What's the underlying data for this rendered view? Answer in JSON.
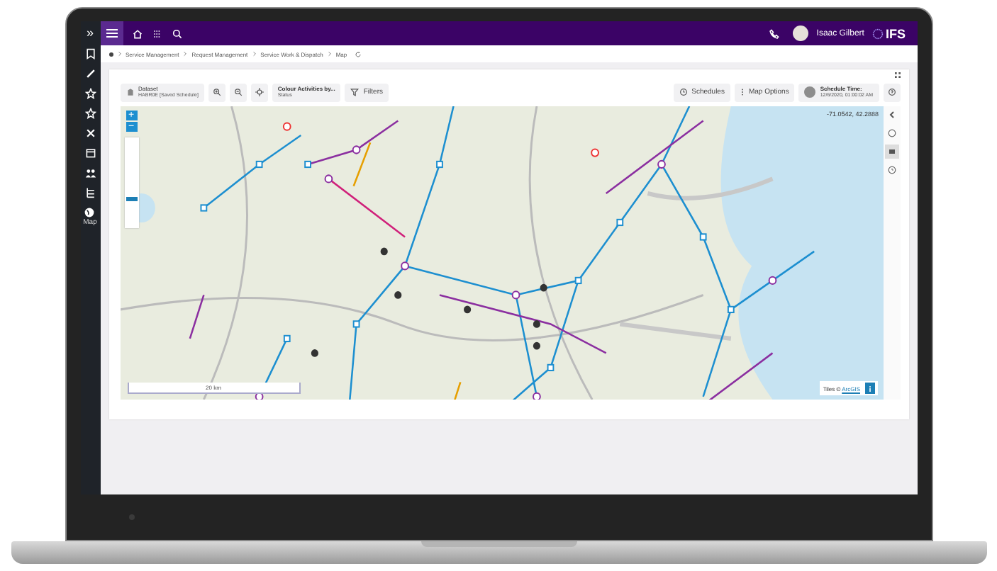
{
  "sidebar": {
    "toggle": "»",
    "items": [
      {
        "kind": "bookmark"
      },
      {
        "kind": "pencil"
      },
      {
        "kind": "star"
      },
      {
        "kind": "star"
      },
      {
        "kind": "tools"
      },
      {
        "kind": "calendar"
      },
      {
        "kind": "people"
      },
      {
        "kind": "tree"
      },
      {
        "kind": "globe",
        "label": "Map"
      }
    ]
  },
  "header": {
    "user": "Isaac Gilbert",
    "logo": "IFS"
  },
  "breadcrumb": [
    "Service Management",
    "Request Management",
    "Service Work & Dispatch",
    "Map"
  ],
  "toolbar": {
    "dataset": {
      "label": "Dataset",
      "value": "HABR0E [Saved Schedule]"
    },
    "colour": {
      "label": "Colour Activities by...",
      "value": "Status"
    },
    "filters": "Filters",
    "schedules": "Schedules",
    "map_options": "Map Options",
    "schedule_time": {
      "label": "Schedule Time:",
      "value": "12/6/2020, 01:00:02 AM"
    }
  },
  "map": {
    "zoom_in": "+",
    "zoom_out": "−",
    "zoom_slider": {
      "level": 0.3
    },
    "coordinates": "-71.0542, 42.2888",
    "scale": "20 km",
    "attribution": "Tiles © ",
    "attribution_link": "ArcGIS"
  }
}
